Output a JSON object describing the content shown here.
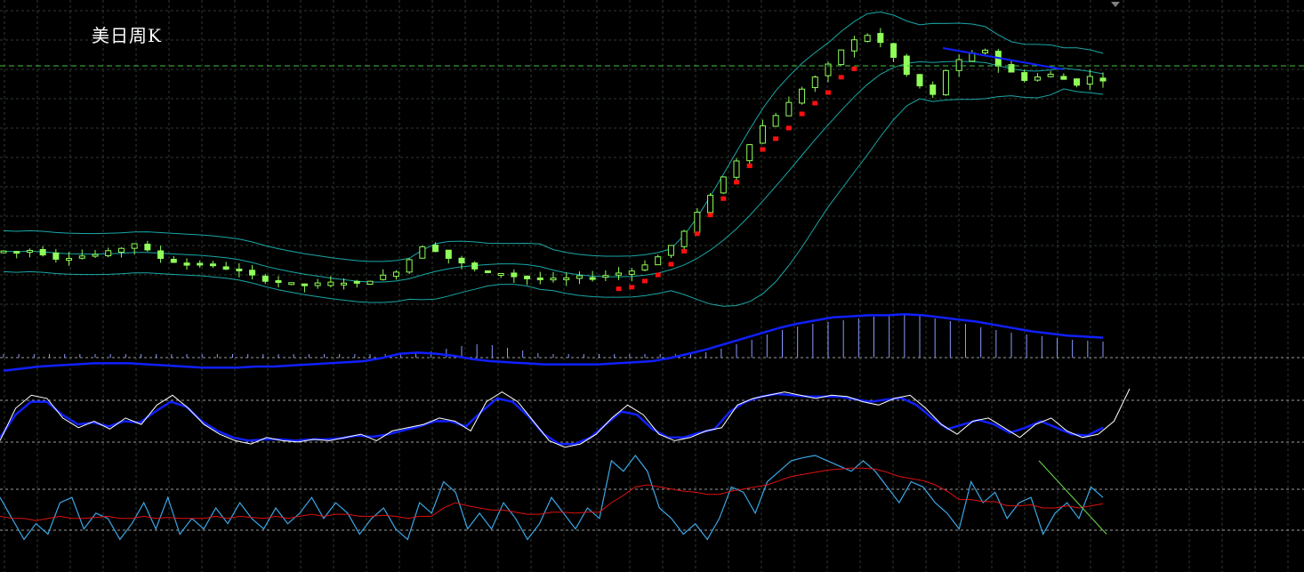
{
  "title": "美日周K",
  "colors": {
    "background": "#000000",
    "grid": "#2e3a2e",
    "candle": "#90ff5a",
    "candle_wick": "#ffffff",
    "bollinger": "#1aa7a7",
    "sar": "#ff1010",
    "trend_line": "#1020ff",
    "price_level_line": "#44c044",
    "macd_hist": "#8a9aff",
    "macd_signal": "#1020ff",
    "stoch_main": "#ffffff",
    "stoch_signal": "#1020ff",
    "rsi_fast": "#3aa7e6",
    "rsi_slow": "#e01010",
    "rsi_trend": "#6cd84a",
    "level_lines": "#cfcfcf"
  },
  "chart_data": [
    {
      "type": "candlestick",
      "name": "price",
      "overlays": [
        "bollinger-bands",
        "parabolic-sar",
        "horizontal-level"
      ],
      "grid": true,
      "price_path": [
        85,
        84,
        86,
        83,
        79,
        80,
        81,
        82,
        84,
        88,
        92,
        85,
        79,
        76,
        73,
        74,
        72,
        70,
        67,
        63,
        60,
        58,
        56,
        55,
        56,
        57,
        58,
        57,
        60,
        63,
        68,
        78,
        90,
        86,
        79,
        74,
        69,
        66,
        66,
        63,
        61,
        60,
        60,
        61,
        62,
        63,
        64,
        66,
        68,
        74,
        80,
        90,
        102,
        118,
        135,
        150,
        165,
        180,
        195,
        205,
        215,
        228,
        238,
        248,
        262,
        270,
        275,
        268,
        255,
        240,
        230,
        222,
        244,
        252,
        258,
        262,
        248,
        242,
        236,
        238,
        240,
        236,
        232,
        238,
        236
      ]
    },
    {
      "type": "bar",
      "name": "macd",
      "series": [
        {
          "name": "",
          "render": "histogram",
          "values": [
            4,
            4,
            4,
            4,
            4,
            4,
            4,
            4,
            4,
            4,
            4,
            4,
            4,
            4,
            4,
            4,
            4,
            4,
            4,
            4,
            4,
            4,
            4,
            4,
            4,
            4,
            4,
            5,
            7,
            10,
            13,
            15,
            14,
            11,
            8,
            5,
            4,
            4,
            4,
            4,
            4,
            4,
            4,
            4,
            4,
            4,
            6,
            10,
            15,
            20,
            26,
            31,
            35,
            38,
            40,
            42,
            44,
            46,
            47,
            48,
            47,
            44,
            41,
            38,
            34,
            31,
            28,
            26,
            24,
            22,
            20,
            19,
            18
          ]
        },
        {
          "name": "",
          "render": "line",
          "values": [
            -4,
            -2,
            0,
            1,
            2,
            3,
            3,
            3,
            2,
            1,
            0,
            -1,
            -1,
            -1,
            0,
            0,
            1,
            2,
            3,
            4,
            5,
            8,
            12,
            13,
            12,
            10,
            7,
            5,
            4,
            3,
            2,
            2,
            2,
            2,
            3,
            4,
            5,
            8,
            12,
            16,
            21,
            26,
            31,
            36,
            40,
            43,
            46,
            47,
            48,
            48,
            49,
            48,
            46,
            44,
            42,
            39,
            36,
            33,
            31,
            29,
            28,
            27
          ]
        }
      ]
    },
    {
      "type": "line",
      "name": "stochastic",
      "ylim": [
        0,
        100
      ],
      "levels": [
        80,
        20
      ],
      "series": [
        {
          "name": "",
          "values": [
            20,
            70,
            90,
            85,
            55,
            40,
            50,
            38,
            55,
            45,
            75,
            90,
            70,
            45,
            30,
            20,
            15,
            25,
            20,
            18,
            22,
            20,
            25,
            30,
            20,
            35,
            40,
            45,
            55,
            50,
            35,
            80,
            95,
            80,
            50,
            20,
            10,
            15,
            30,
            55,
            75,
            60,
            30,
            20,
            25,
            35,
            40,
            75,
            85,
            90,
            95,
            90,
            85,
            90,
            88,
            80,
            75,
            85,
            90,
            70,
            45,
            30,
            50,
            55,
            40,
            25,
            45,
            55,
            35,
            25,
            30,
            50,
            100
          ]
        },
        {
          "name": "",
          "values": [
            25,
            60,
            80,
            80,
            60,
            45,
            48,
            42,
            50,
            48,
            65,
            80,
            72,
            50,
            35,
            25,
            20,
            22,
            22,
            20,
            22,
            22,
            24,
            28,
            26,
            30,
            36,
            42,
            50,
            50,
            42,
            65,
            85,
            80,
            58,
            30,
            15,
            15,
            25,
            45,
            65,
            60,
            38,
            25,
            25,
            32,
            38,
            65,
            80,
            88,
            92,
            90,
            88,
            88,
            88,
            84,
            80,
            83,
            86,
            75,
            55,
            38,
            45,
            52,
            45,
            32,
            40,
            50,
            40,
            30,
            28,
            40
          ]
        }
      ]
    },
    {
      "type": "line",
      "name": "oscillator",
      "ylim": [
        0,
        100
      ],
      "levels": [
        70,
        30
      ],
      "series": [
        {
          "name": "",
          "values": [
            60,
            40,
            20,
            35,
            25,
            55,
            60,
            30,
            45,
            40,
            20,
            35,
            55,
            30,
            60,
            25,
            40,
            30,
            50,
            35,
            55,
            40,
            30,
            50,
            35,
            45,
            60,
            40,
            55,
            45,
            25,
            40,
            50,
            30,
            20,
            55,
            45,
            75,
            65,
            30,
            45,
            30,
            55,
            40,
            20,
            35,
            60,
            45,
            30,
            50,
            40,
            95,
            85,
            100,
            85,
            50,
            40,
            25,
            35,
            20,
            40,
            70,
            65,
            45,
            75,
            85,
            95,
            98,
            100,
            95,
            90,
            85,
            95,
            85,
            70,
            55,
            75,
            70,
            55,
            45,
            30,
            75,
            55,
            65,
            40,
            55,
            60,
            25,
            45,
            55,
            40,
            70,
            60
          ]
        },
        {
          "name": "",
          "values": [
            42,
            40,
            40,
            38,
            40,
            42,
            40,
            40,
            41,
            42,
            40,
            40,
            42,
            40,
            41,
            40,
            40,
            40,
            42,
            40,
            42,
            41,
            40,
            42,
            40,
            42,
            44,
            42,
            44,
            44,
            42,
            42,
            43,
            42,
            40,
            42,
            42,
            50,
            55,
            52,
            50,
            48,
            48,
            46,
            44,
            44,
            46,
            46,
            45,
            46,
            46,
            55,
            62,
            70,
            72,
            70,
            68,
            66,
            65,
            63,
            63,
            66,
            68,
            70,
            72,
            76,
            80,
            82,
            84,
            86,
            87,
            88,
            88,
            87,
            84,
            80,
            78,
            76,
            72,
            66,
            58,
            58,
            56,
            56,
            52,
            52,
            53,
            50,
            50,
            52,
            50,
            52,
            54
          ]
        },
        {
          "name": "",
          "render": "trend-line",
          "values": [
            95,
            25
          ]
        }
      ]
    }
  ]
}
